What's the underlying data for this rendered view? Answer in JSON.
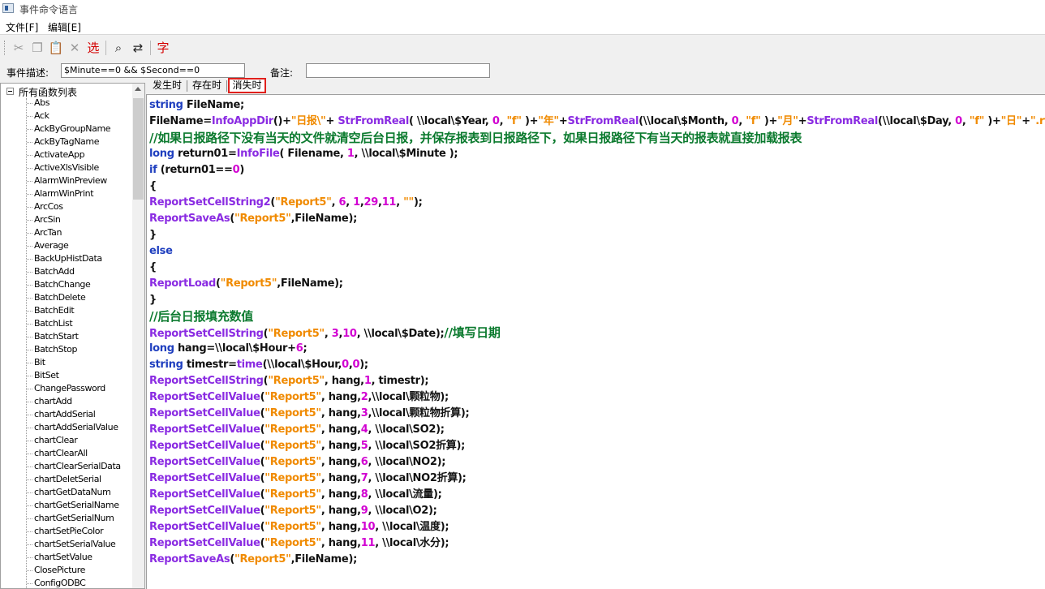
{
  "window": {
    "title": "事件命令语言",
    "icon": "app-window-icon"
  },
  "menu": [
    {
      "label": "文件[F]"
    },
    {
      "label": "编辑[E]"
    }
  ],
  "toolbar": {
    "buttons": [
      {
        "icon": "cut-icon",
        "glyph": "✂",
        "color": "#9a9a9a"
      },
      {
        "icon": "copy-icon",
        "glyph": "❐",
        "color": "#9a9a9a"
      },
      {
        "icon": "paste-icon",
        "glyph": "📋",
        "color": "#333333"
      },
      {
        "icon": "delete-icon",
        "glyph": "✕",
        "color": "#9a9a9a"
      },
      {
        "icon": "select-icon",
        "glyph": "选",
        "color": "#d40000"
      },
      {
        "icon": "find-icon",
        "glyph": "⌕",
        "color": "#222222"
      },
      {
        "icon": "replace-icon",
        "glyph": "⇄",
        "color": "#222222"
      },
      {
        "icon": "font-icon",
        "glyph": "字",
        "color": "#d40000"
      }
    ]
  },
  "desc": {
    "label": "事件描述:",
    "value": "$Minute==0 && $Second==0",
    "remark_label": "备注:",
    "remark_value": ""
  },
  "tree": {
    "root": "所有函数列表",
    "items": [
      "Abs",
      "Ack",
      "AckByGroupName",
      "AckByTagName",
      "ActivateApp",
      "ActiveXlsVisible",
      "AlarmWinPreview",
      "AlarmWinPrint",
      "ArcCos",
      "ArcSin",
      "ArcTan",
      "Average",
      "BackUpHistData",
      "BatchAdd",
      "BatchChange",
      "BatchDelete",
      "BatchEdit",
      "BatchList",
      "BatchStart",
      "BatchStop",
      "Bit",
      "BitSet",
      "ChangePassword",
      "chartAdd",
      "chartAddSerial",
      "chartAddSerialValue",
      "chartClear",
      "chartClearAll",
      "chartClearSerialData",
      "chartDeletSerial",
      "chartGetDataNum",
      "chartGetSerialName",
      "chartGetSerialNum",
      "chartSetPieColor",
      "chartSetSerialValue",
      "chartSetValue",
      "ClosePicture",
      "ConfigODBC"
    ]
  },
  "tabs": [
    {
      "label": "发生时"
    },
    {
      "label": "存在时"
    },
    {
      "label": "消失时",
      "active": true
    }
  ],
  "code": [
    [
      [
        "kw",
        "string"
      ],
      [
        "tx",
        " FileName;"
      ]
    ],
    [
      [
        "tx",
        "FileName="
      ],
      [
        "fn",
        "InfoAppDir"
      ],
      [
        "tx",
        "()+"
      ],
      [
        "str",
        "\"日报\\\""
      ],
      [
        "tx",
        "+ "
      ],
      [
        "fn",
        "StrFromReal"
      ],
      [
        "tx",
        "( \\\\local\\$Year, "
      ],
      [
        "num",
        "0"
      ],
      [
        "tx",
        ", "
      ],
      [
        "str",
        "\"f\""
      ],
      [
        "tx",
        " )+"
      ],
      [
        "str",
        "\"年\""
      ],
      [
        "tx",
        "+"
      ],
      [
        "fn",
        "StrFromReal"
      ],
      [
        "tx",
        "(\\\\local\\$Month, "
      ],
      [
        "num",
        "0"
      ],
      [
        "tx",
        ", "
      ],
      [
        "str",
        "\"f\""
      ],
      [
        "tx",
        " )+"
      ],
      [
        "str",
        "\"月\""
      ],
      [
        "tx",
        "+"
      ],
      [
        "fn",
        "StrFromReal"
      ],
      [
        "tx",
        "(\\\\local\\$Day, "
      ],
      [
        "num",
        "0"
      ],
      [
        "tx",
        ", "
      ],
      [
        "str",
        "\"f\""
      ],
      [
        "tx",
        " )+"
      ],
      [
        "str",
        "\"日\""
      ],
      [
        "tx",
        "+"
      ],
      [
        "str",
        "\".rtl\""
      ],
      [
        "tx",
        ";"
      ]
    ],
    [
      [
        "cm",
        "//如果日报路径下没有当天的文件就清空后台日报，并保存报表到日报路径下，如果日报路径下有当天的报表就直接加载报表"
      ]
    ],
    [
      [
        "kw",
        "long"
      ],
      [
        "tx",
        " return01="
      ],
      [
        "fn",
        "InfoFile"
      ],
      [
        "tx",
        "( Filename, "
      ],
      [
        "num",
        "1"
      ],
      [
        "tx",
        ", \\\\local\\$Minute );"
      ]
    ],
    [
      [
        "kw",
        "if"
      ],
      [
        "tx",
        " (return01=="
      ],
      [
        "num",
        "0"
      ],
      [
        "tx",
        ")"
      ]
    ],
    [
      [
        "tx",
        "{"
      ]
    ],
    [
      [
        "fn",
        "ReportSetCellString2"
      ],
      [
        "tx",
        "("
      ],
      [
        "str",
        "\"Report5\""
      ],
      [
        "tx",
        ", "
      ],
      [
        "num",
        "6"
      ],
      [
        "tx",
        ", "
      ],
      [
        "num",
        "1"
      ],
      [
        "tx",
        ","
      ],
      [
        "num",
        "29"
      ],
      [
        "tx",
        ","
      ],
      [
        "num",
        "11"
      ],
      [
        "tx",
        ", "
      ],
      [
        "str",
        "\"\""
      ],
      [
        "tx",
        ");"
      ]
    ],
    [
      [
        "fn",
        "ReportSaveAs"
      ],
      [
        "tx",
        "("
      ],
      [
        "str",
        "\"Report5\""
      ],
      [
        "tx",
        ",FileName);"
      ]
    ],
    [
      [
        "tx",
        "}"
      ]
    ],
    [
      [
        "kw",
        "else"
      ]
    ],
    [
      [
        "tx",
        "{"
      ]
    ],
    [
      [
        "fn",
        "ReportLoad"
      ],
      [
        "tx",
        "("
      ],
      [
        "str",
        "\"Report5\""
      ],
      [
        "tx",
        ",FileName);"
      ]
    ],
    [
      [
        "tx",
        "}"
      ]
    ],
    [
      [
        "cm",
        "//后台日报填充数值"
      ]
    ],
    [
      [
        "fn",
        "ReportSetCellString"
      ],
      [
        "tx",
        "("
      ],
      [
        "str",
        "\"Report5\""
      ],
      [
        "tx",
        ", "
      ],
      [
        "num",
        "3"
      ],
      [
        "tx",
        ","
      ],
      [
        "num",
        "10"
      ],
      [
        "tx",
        ", \\\\local\\$Date);"
      ],
      [
        "cm",
        "//填写日期"
      ]
    ],
    [
      [
        "kw",
        "long"
      ],
      [
        "tx",
        " hang=\\\\local\\$Hour+"
      ],
      [
        "num",
        "6"
      ],
      [
        "tx",
        ";"
      ]
    ],
    [
      [
        "kw",
        "string"
      ],
      [
        "tx",
        " timestr="
      ],
      [
        "fn",
        "time"
      ],
      [
        "tx",
        "(\\\\local\\$Hour,"
      ],
      [
        "num",
        "0"
      ],
      [
        "tx",
        ","
      ],
      [
        "num",
        "0"
      ],
      [
        "tx",
        ");"
      ]
    ],
    [
      [
        "fn",
        "ReportSetCellString"
      ],
      [
        "tx",
        "("
      ],
      [
        "str",
        "\"Report5\""
      ],
      [
        "tx",
        ", hang,"
      ],
      [
        "num",
        "1"
      ],
      [
        "tx",
        ", timestr);"
      ]
    ],
    [
      [
        "fn",
        "ReportSetCellValue"
      ],
      [
        "tx",
        "("
      ],
      [
        "str",
        "\"Report5\""
      ],
      [
        "tx",
        ", hang,"
      ],
      [
        "num",
        "2"
      ],
      [
        "tx",
        ",\\\\local\\颗粒物);"
      ]
    ],
    [
      [
        "fn",
        "ReportSetCellValue"
      ],
      [
        "tx",
        "("
      ],
      [
        "str",
        "\"Report5\""
      ],
      [
        "tx",
        ", hang,"
      ],
      [
        "num",
        "3"
      ],
      [
        "tx",
        ",\\\\local\\颗粒物折算);"
      ]
    ],
    [
      [
        "fn",
        "ReportSetCellValue"
      ],
      [
        "tx",
        "("
      ],
      [
        "str",
        "\"Report5\""
      ],
      [
        "tx",
        ", hang,"
      ],
      [
        "num",
        "4"
      ],
      [
        "tx",
        ", \\\\local\\SO2);"
      ]
    ],
    [
      [
        "fn",
        "ReportSetCellValue"
      ],
      [
        "tx",
        "("
      ],
      [
        "str",
        "\"Report5\""
      ],
      [
        "tx",
        ", hang,"
      ],
      [
        "num",
        "5"
      ],
      [
        "tx",
        ", \\\\local\\SO2折算);"
      ]
    ],
    [
      [
        "fn",
        "ReportSetCellValue"
      ],
      [
        "tx",
        "("
      ],
      [
        "str",
        "\"Report5\""
      ],
      [
        "tx",
        ", hang,"
      ],
      [
        "num",
        "6"
      ],
      [
        "tx",
        ", \\\\local\\NO2);"
      ]
    ],
    [
      [
        "fn",
        "ReportSetCellValue"
      ],
      [
        "tx",
        "("
      ],
      [
        "str",
        "\"Report5\""
      ],
      [
        "tx",
        ", hang,"
      ],
      [
        "num",
        "7"
      ],
      [
        "tx",
        ", \\\\local\\NO2折算);"
      ]
    ],
    [
      [
        "fn",
        "ReportSetCellValue"
      ],
      [
        "tx",
        "("
      ],
      [
        "str",
        "\"Report5\""
      ],
      [
        "tx",
        ", hang,"
      ],
      [
        "num",
        "8"
      ],
      [
        "tx",
        ", \\\\local\\流量);"
      ]
    ],
    [
      [
        "fn",
        "ReportSetCellValue"
      ],
      [
        "tx",
        "("
      ],
      [
        "str",
        "\"Report5\""
      ],
      [
        "tx",
        ", hang,"
      ],
      [
        "num",
        "9"
      ],
      [
        "tx",
        ", \\\\local\\O2);"
      ]
    ],
    [
      [
        "fn",
        "ReportSetCellValue"
      ],
      [
        "tx",
        "("
      ],
      [
        "str",
        "\"Report5\""
      ],
      [
        "tx",
        ", hang,"
      ],
      [
        "num",
        "10"
      ],
      [
        "tx",
        ", \\\\local\\温度);"
      ]
    ],
    [
      [
        "fn",
        "ReportSetCellValue"
      ],
      [
        "tx",
        "("
      ],
      [
        "str",
        "\"Report5\""
      ],
      [
        "tx",
        ", hang,"
      ],
      [
        "num",
        "11"
      ],
      [
        "tx",
        ", \\\\local\\水分);"
      ]
    ],
    [
      [
        "fn",
        "ReportSaveAs"
      ],
      [
        "tx",
        "("
      ],
      [
        "str",
        "\"Report5\""
      ],
      [
        "tx",
        ",FileName);"
      ]
    ]
  ]
}
